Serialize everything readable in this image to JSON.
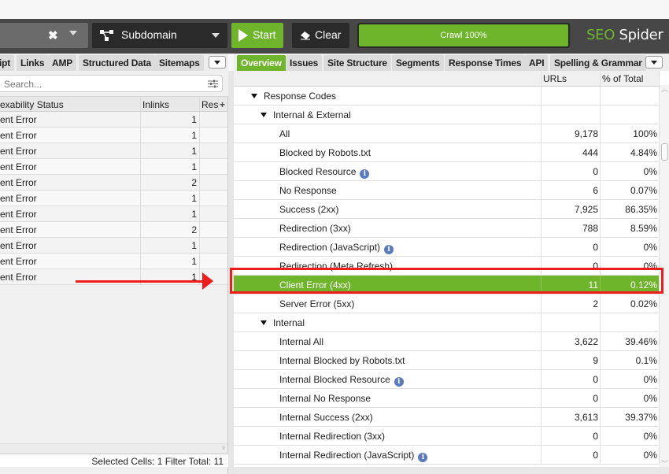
{
  "toolbar": {
    "url_clear_icon": "close-icon",
    "mode_label": "Subdomain",
    "start_label": "Start",
    "clear_label": "Clear",
    "crawl_progress_label": "Crawl 100%",
    "crawl_progress_percent": 100,
    "brand_seo": "SEO",
    "brand_spider": " Spider"
  },
  "left_tabs": [
    "ipt",
    "Links",
    "AMP",
    "Structured Data",
    "Sitemaps"
  ],
  "right_tabs": [
    "Overview",
    "Issues",
    "Site Structure",
    "Segments",
    "Response Times",
    "API",
    "Spelling & Grammar"
  ],
  "right_active_tab": "Overview",
  "left_panel": {
    "search_placeholder": "Search...",
    "columns": [
      "exability Status",
      "Inlinks",
      "Res",
      "+"
    ],
    "rows": [
      {
        "status": "ent Error",
        "inlinks": "1"
      },
      {
        "status": "ent Error",
        "inlinks": "1"
      },
      {
        "status": "ent Error",
        "inlinks": "1"
      },
      {
        "status": "ent Error",
        "inlinks": "1"
      },
      {
        "status": "ent Error",
        "inlinks": "2"
      },
      {
        "status": "ent Error",
        "inlinks": "1"
      },
      {
        "status": "ent Error",
        "inlinks": "1"
      },
      {
        "status": "ent Error",
        "inlinks": "2"
      },
      {
        "status": "ent Error",
        "inlinks": "1"
      },
      {
        "status": "ent Error",
        "inlinks": "1"
      },
      {
        "status": "ent Error",
        "inlinks": "1"
      }
    ],
    "status_bar": "Selected Cells:  1  Filter Total:  11"
  },
  "overview": {
    "columns": [
      "",
      "URLs",
      "% of Total"
    ],
    "rows": [
      {
        "label": "Response Codes",
        "level": 0,
        "expandable": true,
        "urls": "",
        "pct": ""
      },
      {
        "label": "Internal & External",
        "level": 1,
        "expandable": true,
        "urls": "",
        "pct": ""
      },
      {
        "label": "All",
        "level": 2,
        "urls": "9,178",
        "pct": "100%"
      },
      {
        "label": "Blocked by Robots.txt",
        "level": 2,
        "urls": "444",
        "pct": "4.84%"
      },
      {
        "label": "Blocked Resource",
        "level": 2,
        "info": true,
        "urls": "0",
        "pct": "0%"
      },
      {
        "label": "No Response",
        "level": 2,
        "urls": "6",
        "pct": "0.07%"
      },
      {
        "label": "Success (2xx)",
        "level": 2,
        "urls": "7,925",
        "pct": "86.35%"
      },
      {
        "label": "Redirection (3xx)",
        "level": 2,
        "urls": "788",
        "pct": "8.59%"
      },
      {
        "label": "Redirection (JavaScript)",
        "level": 2,
        "info": true,
        "urls": "0",
        "pct": "0%"
      },
      {
        "label": "Redirection (Meta Refresh)",
        "level": 2,
        "urls": "0",
        "pct": "0%"
      },
      {
        "label": "Client Error (4xx)",
        "level": 2,
        "urls": "11",
        "pct": "0.12%",
        "selected": true
      },
      {
        "label": "Server Error (5xx)",
        "level": 2,
        "urls": "2",
        "pct": "0.02%"
      },
      {
        "label": "Internal",
        "level": 1,
        "expandable": true,
        "urls": "",
        "pct": ""
      },
      {
        "label": "Internal All",
        "level": 2,
        "urls": "3,622",
        "pct": "39.46%"
      },
      {
        "label": "Internal Blocked by Robots.txt",
        "level": 2,
        "urls": "9",
        "pct": "0.1%"
      },
      {
        "label": "Internal Blocked Resource",
        "level": 2,
        "info": true,
        "urls": "0",
        "pct": "0%"
      },
      {
        "label": "Internal No Response",
        "level": 2,
        "urls": "0",
        "pct": "0%"
      },
      {
        "label": "Internal Success (2xx)",
        "level": 2,
        "urls": "3,613",
        "pct": "39.37%"
      },
      {
        "label": "Internal Redirection (3xx)",
        "level": 2,
        "urls": "0",
        "pct": "0%"
      },
      {
        "label": "Internal Redirection (JavaScript)",
        "level": 2,
        "info": true,
        "urls": "0",
        "pct": "0%"
      }
    ]
  },
  "annotation": {
    "highlight_color": "#ee1c1c",
    "accent_color": "#6fb52c"
  }
}
